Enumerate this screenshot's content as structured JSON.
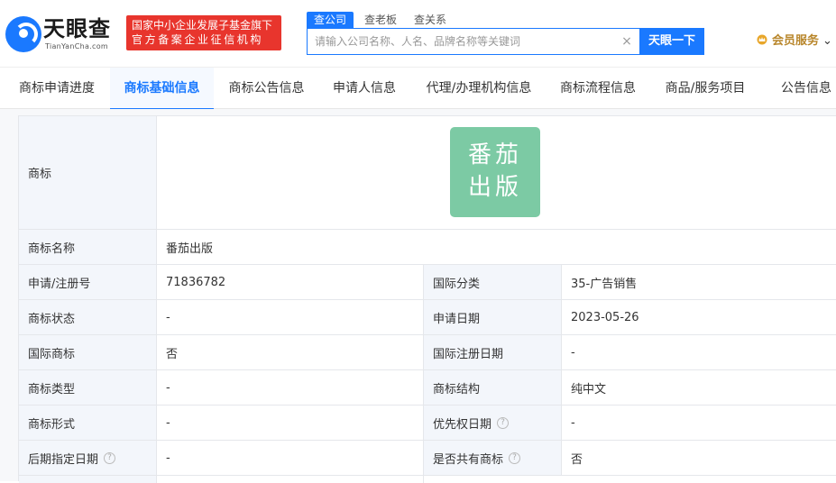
{
  "header": {
    "logo": {
      "name": "天眼查",
      "domain": "TianYanCha.com"
    },
    "fund_badge": {
      "line1": "国家中小企业发展子基金旗下",
      "line2": "官方备案企业征信机构"
    },
    "search_tabs": [
      "查公司",
      "查老板",
      "查关系"
    ],
    "search": {
      "placeholder": "请输入公司名称、人名、品牌名称等关键词",
      "value": "",
      "clear_icon": "×",
      "button_label": "天眼一下"
    },
    "vip": {
      "label": "会员服务",
      "caret": "⌄"
    }
  },
  "tabs": [
    "商标申请进度",
    "商标基础信息",
    "商标公告信息",
    "申请人信息",
    "代理/办理机构信息",
    "商标流程信息",
    "商品/服务项目",
    "公告信息"
  ],
  "active_tab": "商标基础信息",
  "trademark": {
    "logo_label": "商标",
    "logo_text": "番茄\n出版",
    "logo_color": "#7ccaa4",
    "name_label": "商标名称",
    "name_value": "番茄出版",
    "rows": [
      {
        "l1": "申请/注册号",
        "v1": "71836782",
        "l2": "国际分类",
        "v2": "35-广告销售"
      },
      {
        "l1": "商标状态",
        "v1": "-",
        "l2": "申请日期",
        "v2": "2023-05-26"
      },
      {
        "l1": "国际商标",
        "v1": "否",
        "l2": "国际注册日期",
        "v2": "-"
      },
      {
        "l1": "商标类型",
        "v1": "-",
        "l2": "商标结构",
        "v2": "纯中文"
      },
      {
        "l1": "商标形式",
        "v1": "-",
        "l2": "优先权日期",
        "v2": "-"
      },
      {
        "l1": "后期指定日期",
        "v1": "-",
        "l2": "是否共有商标",
        "v2": "否"
      }
    ]
  },
  "colors": {
    "brand_blue": "#1a79ff",
    "badge_red": "#e8352d",
    "vip_gold": "#b8862b",
    "label_bg": "#f3f6fb"
  }
}
